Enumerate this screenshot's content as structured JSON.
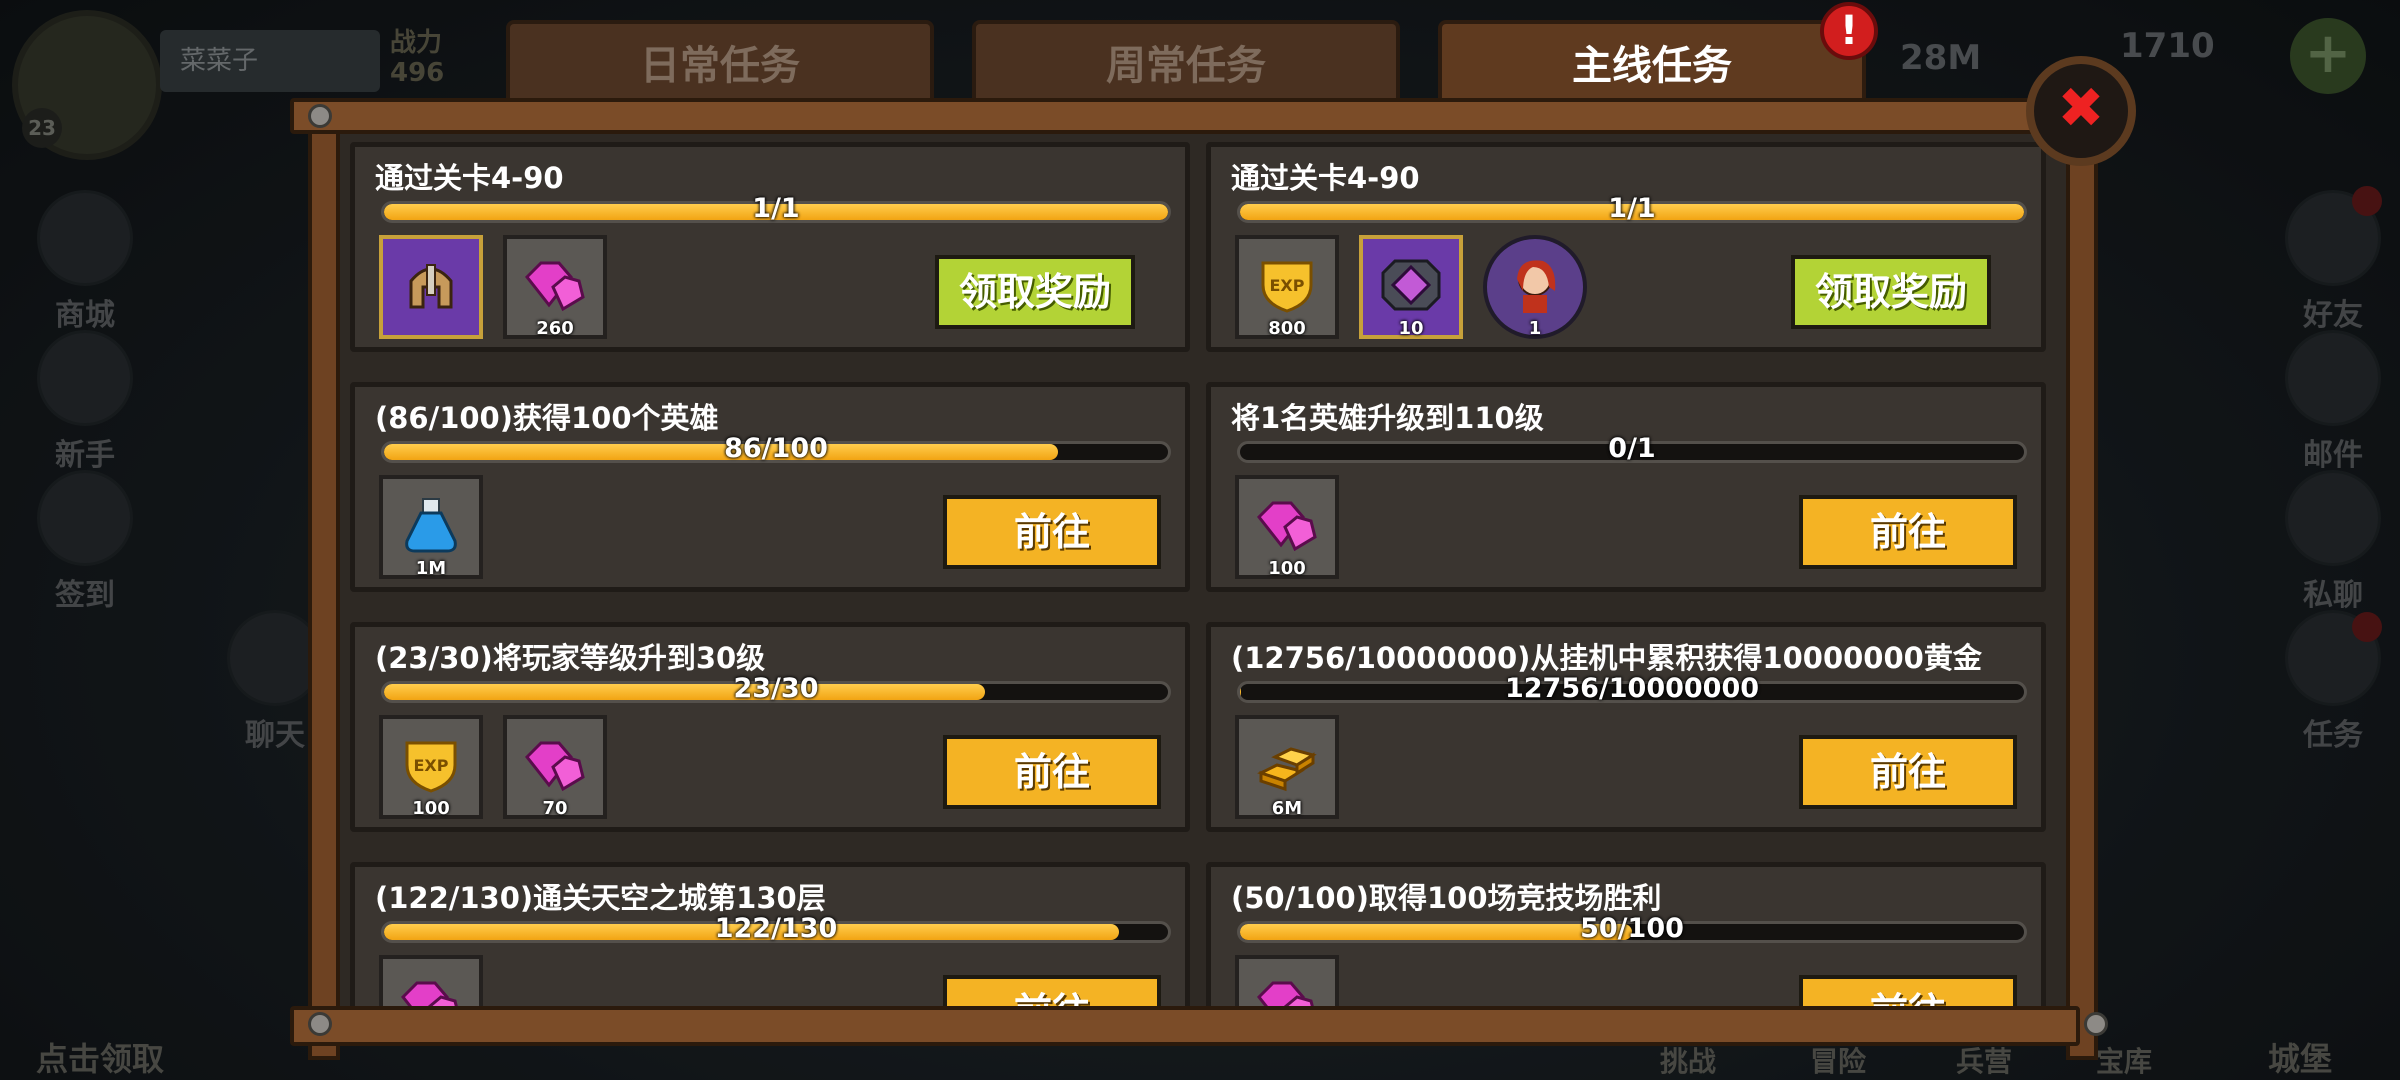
{
  "header": {
    "player_name": "菜菜子",
    "level": "23",
    "power_label": "战力",
    "power_value": "496",
    "gold": "28M",
    "gems": "1710",
    "plus": "+"
  },
  "tabs": [
    {
      "label": "日常任务",
      "active": false
    },
    {
      "label": "周常任务",
      "active": false
    },
    {
      "label": "主线任务",
      "active": true
    }
  ],
  "tab_alert": "!",
  "close_label": "✖",
  "side_left": [
    "商城",
    "新手",
    "签到",
    "聊天"
  ],
  "side_right": [
    "好友",
    "邮件",
    "私聊",
    "任务"
  ],
  "bottom_left": "点击领取",
  "bottom_right": [
    "挑战",
    "冒险",
    "兵营",
    "宝库",
    "城堡"
  ],
  "tasks": [
    {
      "title": "通过关卡4-90",
      "progress_text": "1/1",
      "progress": 1.0,
      "rewards": [
        {
          "icon": "helmet-icon",
          "qty": ""
        },
        {
          "icon": "pink-gem-icon",
          "qty": "260"
        }
      ],
      "button": "领取奖励",
      "button_type": "claim"
    },
    {
      "title": "通过关卡4-90",
      "progress_text": "1/1",
      "progress": 1.0,
      "rewards": [
        {
          "icon": "exp-shield-icon",
          "qty": "800"
        },
        {
          "icon": "crystal-box-icon",
          "qty": "10"
        },
        {
          "icon": "hero-portrait-icon",
          "qty": "1"
        }
      ],
      "button": "领取奖励",
      "button_type": "claim"
    },
    {
      "title": "(86/100)获得100个英雄",
      "progress_text": "86/100",
      "progress": 0.86,
      "rewards": [
        {
          "icon": "potion-flask-icon",
          "qty": "1M"
        }
      ],
      "button": "前往",
      "button_type": "go"
    },
    {
      "title": "将1名英雄升级到110级",
      "progress_text": "0/1",
      "progress": 0.0,
      "rewards": [
        {
          "icon": "pink-gem-icon",
          "qty": "100"
        }
      ],
      "button": "前往",
      "button_type": "go"
    },
    {
      "title": "(23/30)将玩家等级升到30级",
      "progress_text": "23/30",
      "progress": 0.767,
      "rewards": [
        {
          "icon": "exp-shield-icon",
          "qty": "100"
        },
        {
          "icon": "pink-gem-icon",
          "qty": "70"
        }
      ],
      "button": "前往",
      "button_type": "go"
    },
    {
      "title": "(12756/10000000)从挂机中累积获得10000000黄金",
      "progress_text": "12756/10000000",
      "progress": 0.0013,
      "rewards": [
        {
          "icon": "gold-bars-icon",
          "qty": "6M"
        }
      ],
      "button": "前往",
      "button_type": "go"
    },
    {
      "title": "(122/130)通关天空之城第130层",
      "progress_text": "122/130",
      "progress": 0.938,
      "rewards": [
        {
          "icon": "pink-gem-icon",
          "qty": ""
        }
      ],
      "button": "前往",
      "button_type": "go"
    },
    {
      "title": "(50/100)取得100场竞技场胜利",
      "progress_text": "50/100",
      "progress": 0.5,
      "rewards": [
        {
          "icon": "pink-gem-icon",
          "qty": ""
        }
      ],
      "button": "前往",
      "button_type": "go"
    }
  ],
  "colors": {
    "bar_fill": "#f2a413",
    "claim_button": "#b3d336",
    "go_button": "#f4b324",
    "active_tab": "#5f3a1f",
    "alert_red": "#d21e1e"
  }
}
